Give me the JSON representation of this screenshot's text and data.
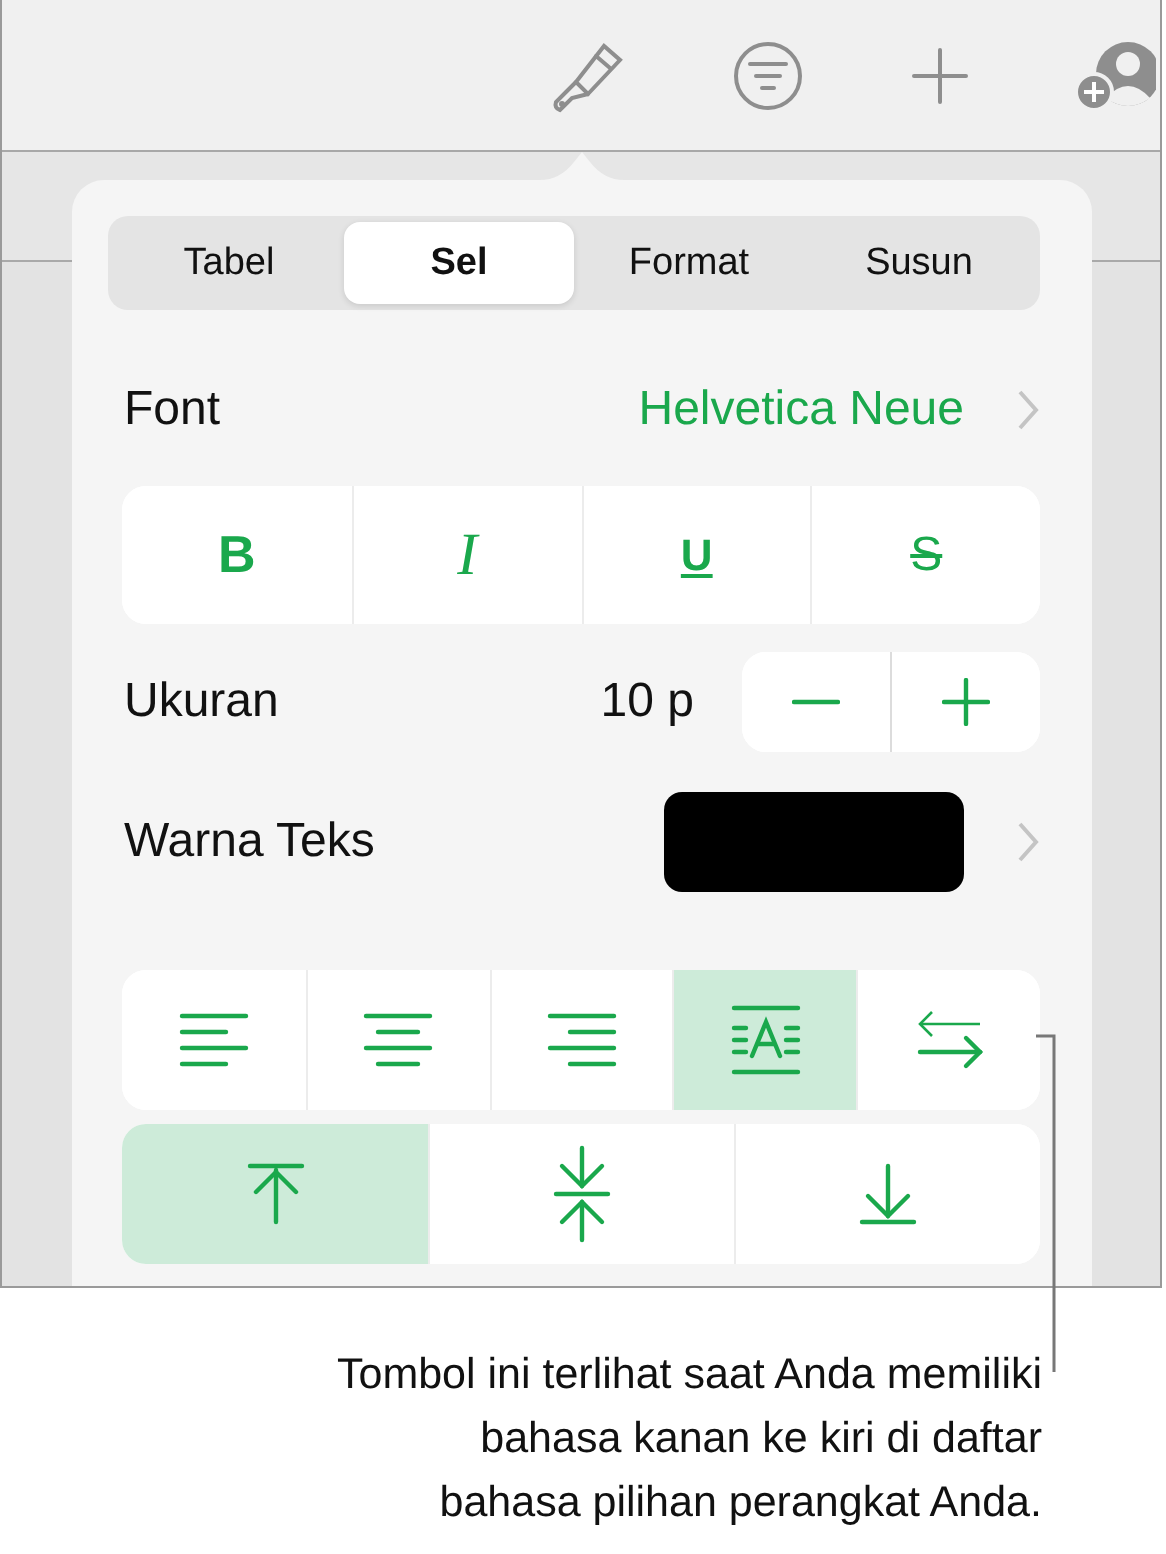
{
  "tabs": [
    {
      "label": "Tabel",
      "selected": false
    },
    {
      "label": "Sel",
      "selected": true
    },
    {
      "label": "Format",
      "selected": false
    },
    {
      "label": "Susun",
      "selected": false
    }
  ],
  "font": {
    "label": "Font",
    "value": "Helvetica Neue"
  },
  "style_buttons": [
    {
      "label": "B",
      "kind": "bold"
    },
    {
      "label": "I",
      "kind": "italic"
    },
    {
      "label": "U",
      "kind": "underline"
    },
    {
      "label": "S",
      "kind": "strike"
    }
  ],
  "size": {
    "label": "Ukuran",
    "value": "10 p"
  },
  "text_color": {
    "label": "Warna Teks",
    "color": "#000000"
  },
  "alignment": [
    {
      "kind": "left",
      "selected": false
    },
    {
      "kind": "center",
      "selected": false
    },
    {
      "kind": "right",
      "selected": false
    },
    {
      "kind": "justify",
      "selected": true
    },
    {
      "kind": "direction",
      "selected": false
    }
  ],
  "vertical_alignment": [
    {
      "kind": "top",
      "selected": true
    },
    {
      "kind": "middle",
      "selected": false
    },
    {
      "kind": "bottom",
      "selected": false
    }
  ],
  "callout": {
    "text": "Tombol ini terlihat saat Anda memiliki\nbahasa kanan ke kiri di daftar\nbahasa pilihan perangkat Anda."
  }
}
